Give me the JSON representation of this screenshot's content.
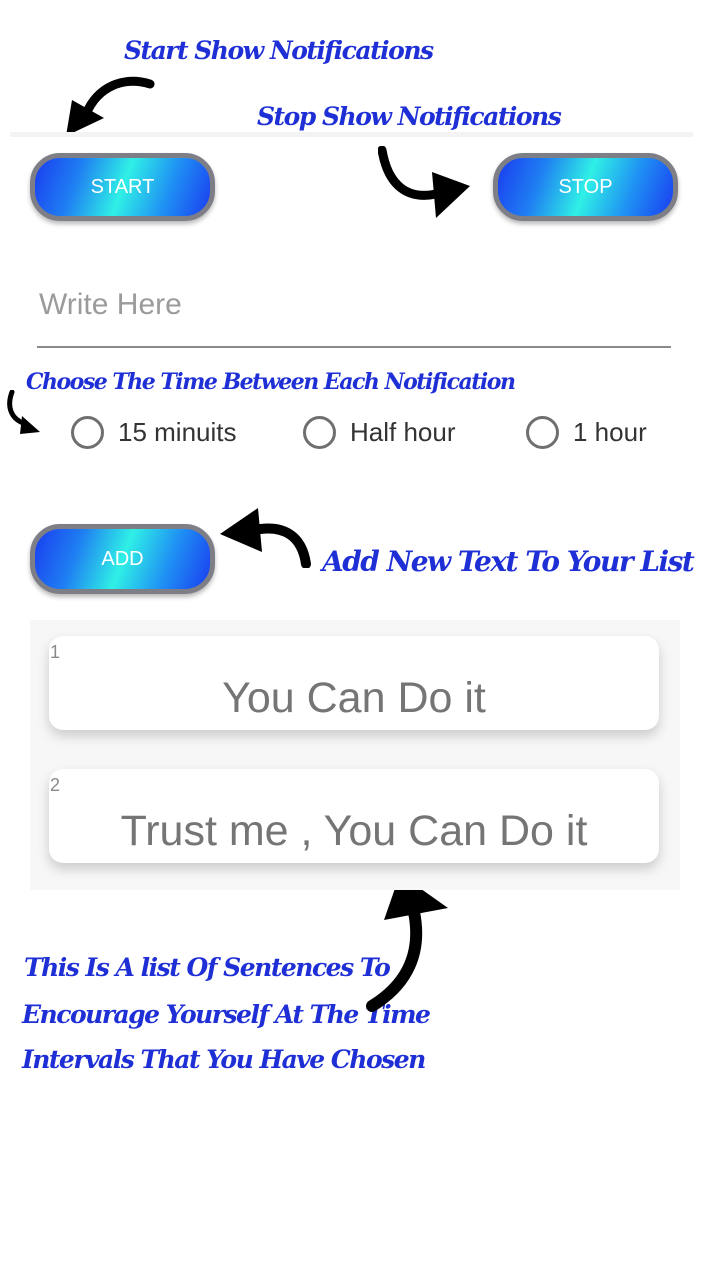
{
  "annotations": {
    "start": "Start Show Notifications",
    "stop": "Stop Show Notifications",
    "choose_time": "Choose The Time Between Each Notification",
    "add_text": "Add New Text To Your List",
    "list_line1": "This Is A list Of Sentences To",
    "list_line2": "Encourage Yourself At The Time",
    "list_line3": "Intervals That You Have Chosen"
  },
  "buttons": {
    "start": "START",
    "stop": "STOP",
    "add": "ADD"
  },
  "input": {
    "placeholder": "Write Here",
    "value": ""
  },
  "interval_options": [
    {
      "label": "15 minuits",
      "selected": false
    },
    {
      "label": "Half hour",
      "selected": false
    },
    {
      "label": "1 hour",
      "selected": false
    }
  ],
  "list_items": [
    {
      "index": "1",
      "text": "You Can Do it"
    },
    {
      "index": "2",
      "text": "Trust me , You Can Do it"
    }
  ],
  "colors": {
    "annotation_text": "#1f2fd6",
    "button_gradient_blue": "#1a3df0",
    "button_gradient_cyan": "#2ff0e6",
    "button_border": "#7e7e86"
  }
}
